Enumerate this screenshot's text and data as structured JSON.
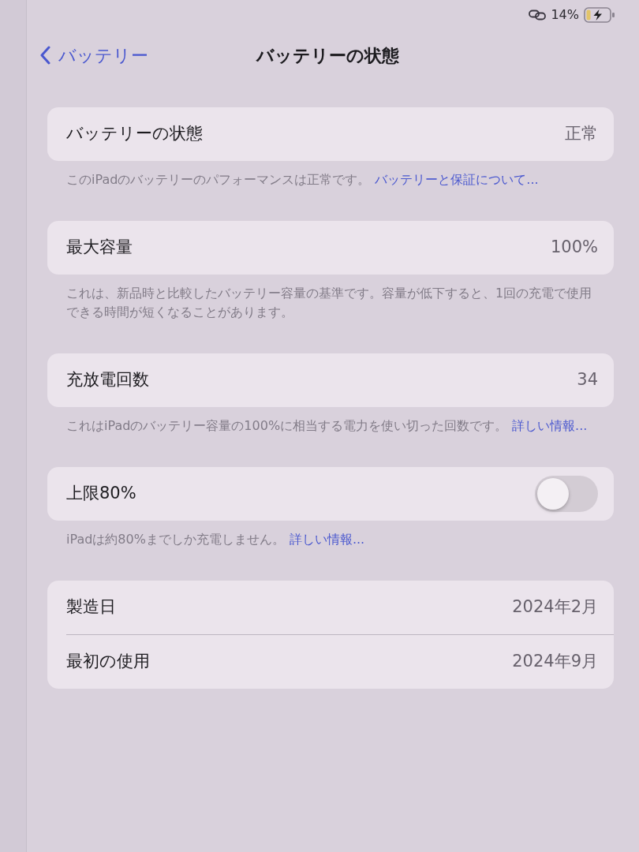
{
  "status_bar": {
    "battery_percent": "14%",
    "charging": true
  },
  "nav": {
    "back_label": "バッテリー",
    "title": "バッテリーの状態"
  },
  "sections": [
    {
      "rows": [
        {
          "kind": "value",
          "label": "バッテリーの状態",
          "value": "正常"
        }
      ],
      "footer": "このiPadのバッテリーのパフォーマンスは正常です。",
      "footer_link": "バッテリーと保証について..."
    },
    {
      "rows": [
        {
          "kind": "value",
          "label": "最大容量",
          "value": "100%"
        }
      ],
      "footer": "これは、新品時と比較したバッテリー容量の基準です。容量が低下すると、1回の充電で使用できる時間が短くなることがあります。"
    },
    {
      "rows": [
        {
          "kind": "value",
          "label": "充放電回数",
          "value": "34"
        }
      ],
      "footer": "これはiPadのバッテリー容量の100%に相当する電力を使い切った回数です。",
      "footer_link": "詳しい情報..."
    },
    {
      "rows": [
        {
          "kind": "toggle",
          "label": "上限80%",
          "on": false
        }
      ],
      "footer": "iPadは約80%までしか充電しません。",
      "footer_link": "詳しい情報..."
    },
    {
      "rows": [
        {
          "kind": "value",
          "label": "製造日",
          "value": "2024年2月"
        },
        {
          "kind": "value",
          "label": "最初の使用",
          "value": "2024年9月"
        }
      ]
    }
  ]
}
